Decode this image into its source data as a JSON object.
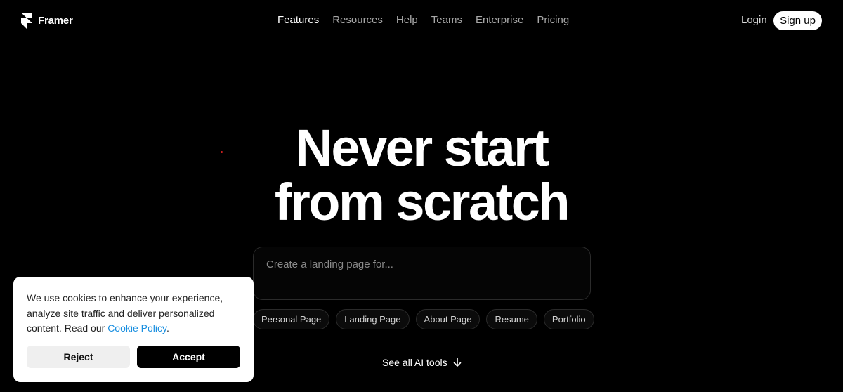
{
  "header": {
    "brand": "Framer",
    "nav": [
      "Features",
      "Resources",
      "Help",
      "Teams",
      "Enterprise",
      "Pricing"
    ],
    "active_nav": "Features",
    "login_label": "Login",
    "signup_label": "Sign up"
  },
  "hero": {
    "title_line1": "Never start",
    "title_line2": "from scratch",
    "prompt_placeholder": "Create a landing page for...",
    "chips": [
      "Personal Page",
      "Landing Page",
      "About Page",
      "Resume",
      "Portfolio"
    ],
    "see_all_label": "See all AI tools",
    "see_all_icon": "arrow-down-icon"
  },
  "cookie_banner": {
    "text": "We use cookies to enhance your experience, analyze site traffic and deliver personalized content. Read our ",
    "link_label": "Cookie Policy",
    "text_end": ".",
    "reject_label": "Reject",
    "accept_label": "Accept"
  },
  "colors": {
    "background": "#000000",
    "accent_link": "#1a8fe0",
    "indicator_dot": "#d32020"
  }
}
